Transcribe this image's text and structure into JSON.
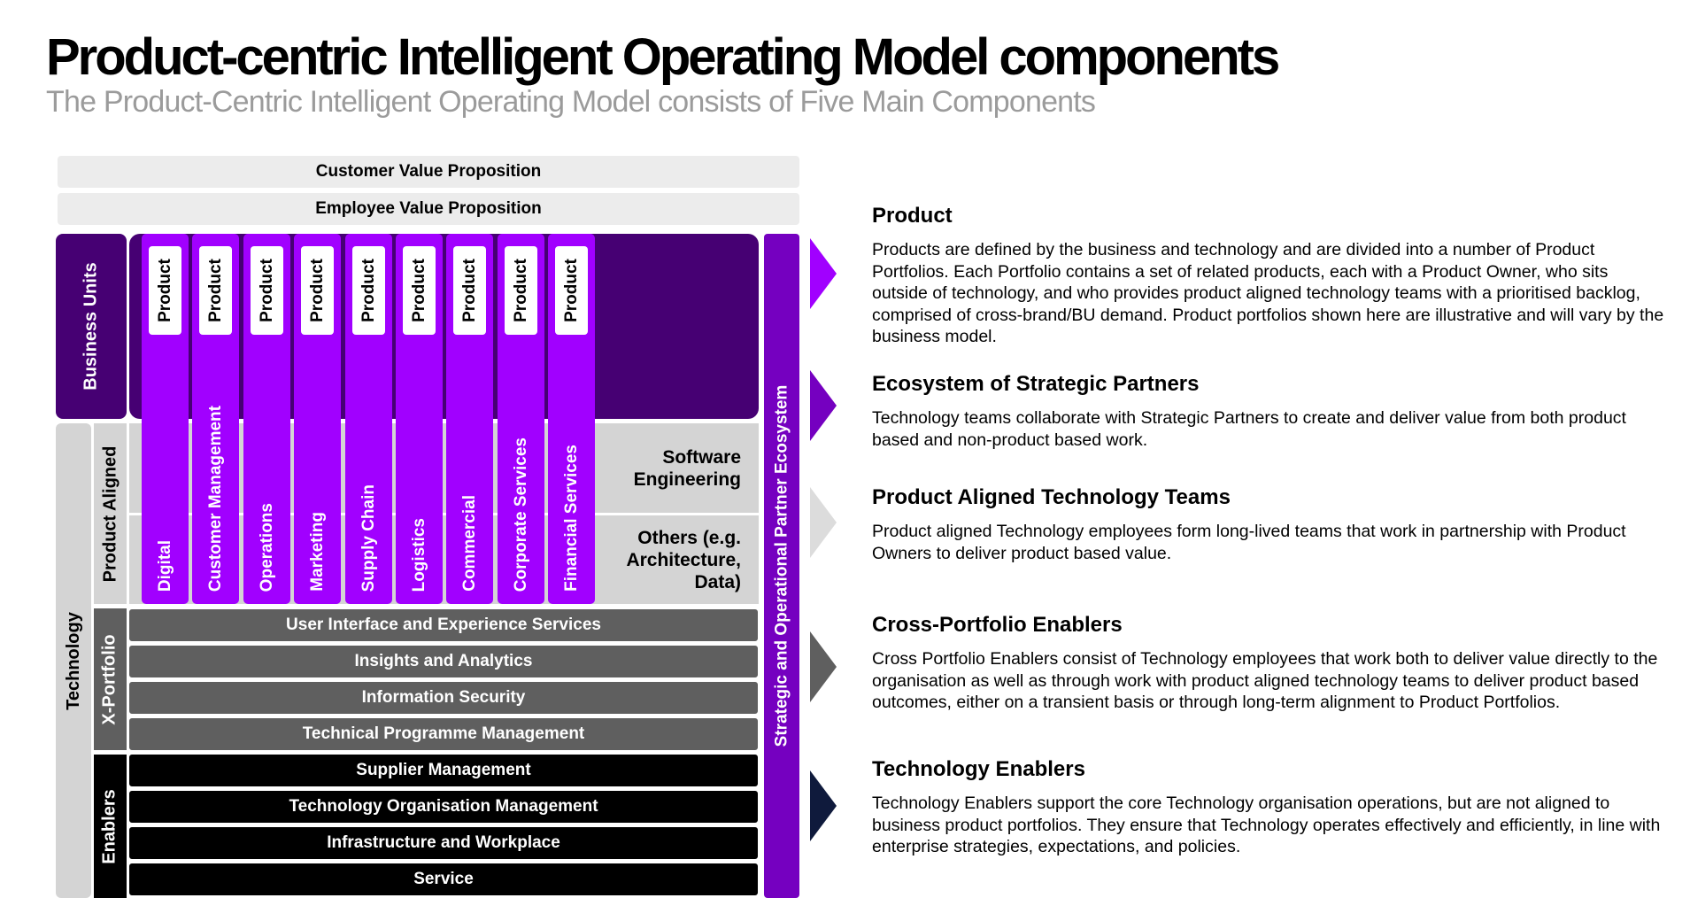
{
  "title": "Product-centric Intelligent Operating Model components",
  "subtitle": "The Product-Centric  Intelligent Operating Model consists of Five Main Components",
  "diagram": {
    "customer_value": "Customer Value Proposition",
    "employee_value": "Employee Value Proposition",
    "business_units": "Business Units",
    "technology": "Technology",
    "product_aligned": "Product Aligned",
    "x_portfolio": "X-Portfolio",
    "enablers": "Enablers",
    "ecosystem": "Strategic and Operational Partner Ecosystem",
    "columns": [
      {
        "product": "Product",
        "label": "Digital"
      },
      {
        "product": "Product",
        "label": "Customer Management"
      },
      {
        "product": "Product",
        "label": "Operations"
      },
      {
        "product": "Product",
        "label": "Marketing"
      },
      {
        "product": "Product",
        "label": "Supply Chain"
      },
      {
        "product": "Product",
        "label": "Logistics"
      },
      {
        "product": "Product",
        "label": "Commercial"
      },
      {
        "product": "Product",
        "label": "Corporate Services"
      },
      {
        "product": "Product",
        "label": "Financial Services"
      }
    ],
    "software_engineering": [
      "Software",
      "Engineering"
    ],
    "others": [
      "Others (e.g.",
      "Architecture,",
      "Data)"
    ],
    "x_portfolio_bars": [
      "User Interface and Experience Services",
      "Insights and Analytics",
      "Information Security",
      "Technical Programme Management"
    ],
    "enabler_bars": [
      "Supplier Management",
      "Technology Organisation Management",
      "Infrastructure and Workplace",
      "Service"
    ]
  },
  "sections": [
    {
      "heading": "Product",
      "body": "Products are defined by the business and technology and are divided into a number of Product Portfolios. Each Portfolio contains a set of related products, each with a Product Owner, who sits outside of technology, and who provides product aligned technology teams with a prioritised backlog, comprised of cross-brand/BU demand. Product portfolios shown here are illustrative and will vary by the business model.",
      "arrow_color": "#a100ff"
    },
    {
      "heading": "Ecosystem of Strategic Partners",
      "body": "Technology teams collaborate with Strategic Partners to create and deliver value from both product based and non-product based work.",
      "arrow_color": "#7500c0"
    },
    {
      "heading": "Product Aligned Technology Teams",
      "body": "Product aligned Technology employees form long-lived teams that work in partnership with Product Owners to deliver product based value.",
      "arrow_color": "#dcdcdc"
    },
    {
      "heading": "Cross-Portfolio Enablers",
      "body": "Cross Portfolio Enablers consist of Technology employees that work both to deliver value directly to the organisation as well as through work with product aligned technology teams to deliver product based outcomes, either on a transient basis or through long-term alignment to Product Portfolios.",
      "arrow_color": "#5f5f5f"
    },
    {
      "heading": "Technology Enablers",
      "body": "Technology Enablers support the core Technology organisation operations, but are not aligned to business product portfolios. They ensure that Technology operates effectively and efficiently, in line with enterprise strategies, expectations, and policies.",
      "arrow_color": "#0f1a3c"
    }
  ]
}
